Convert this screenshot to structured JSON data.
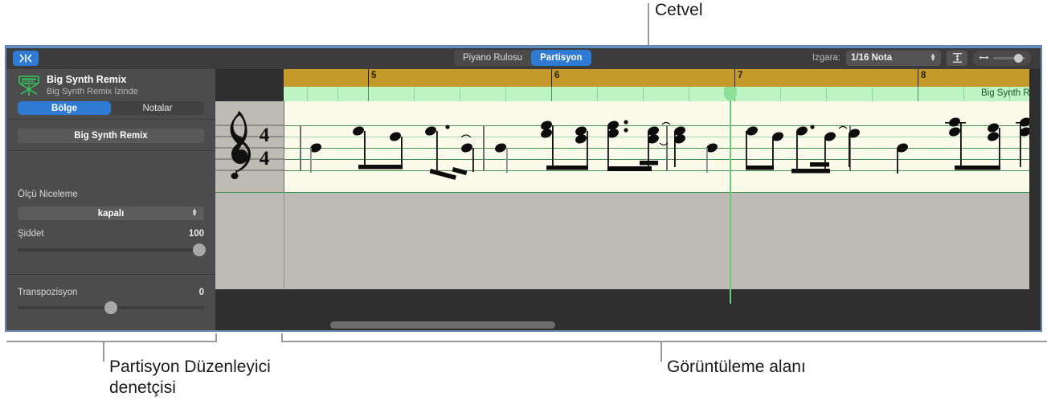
{
  "callouts": {
    "ruler": "Cetvel",
    "inspector": "Partisyon Düzenleyici\ndenetçisi",
    "viewarea": "Görüntüleme alanı"
  },
  "toolbar": {
    "left_icon": "score-editor-icon",
    "segments": [
      {
        "label": "Piyano Rulosu",
        "active": false
      },
      {
        "label": "Partisyon",
        "active": true
      }
    ],
    "grid_label": "Izgara:",
    "grid_value": "1/16 Nota",
    "vertical_zoom_icon": "vertical-resize-icon",
    "horizontal_zoom_icon": "horizontal-resize-icon"
  },
  "sidebar": {
    "track_icon": "synth-keyboard-icon",
    "track_name": "Big Synth Remix",
    "track_subtitle": "Big Synth Remix İzinde",
    "tabs": [
      {
        "label": "Bölge",
        "active": true
      },
      {
        "label": "Notalar",
        "active": false
      }
    ],
    "region_name": "Big Synth Remix",
    "quantize_label": "Ölçü Niceleme",
    "quantize_value": "kapalı",
    "velocity_label": "Şiddet",
    "velocity_value": "100",
    "transpose_label": "Transpozisyon",
    "transpose_value": "0"
  },
  "ruler": {
    "bars": [
      "5",
      "6",
      "7",
      "8"
    ],
    "region_title": "Big Synth Remix"
  },
  "score": {
    "clef": "treble-clef",
    "time_signature_top": "4",
    "time_signature_bottom": "4",
    "rests": [
      "quarter-rest",
      "half-rest"
    ]
  },
  "colors": {
    "accent": "#2f7bd4",
    "ruler": "#c49a2a",
    "region": "#bff5c5",
    "staff": "#4b8e53",
    "paper": "#fbfbec",
    "window_bg": "#3a3a3a",
    "sidebar": "#4c4c4c",
    "playhead": "#66cc77"
  }
}
